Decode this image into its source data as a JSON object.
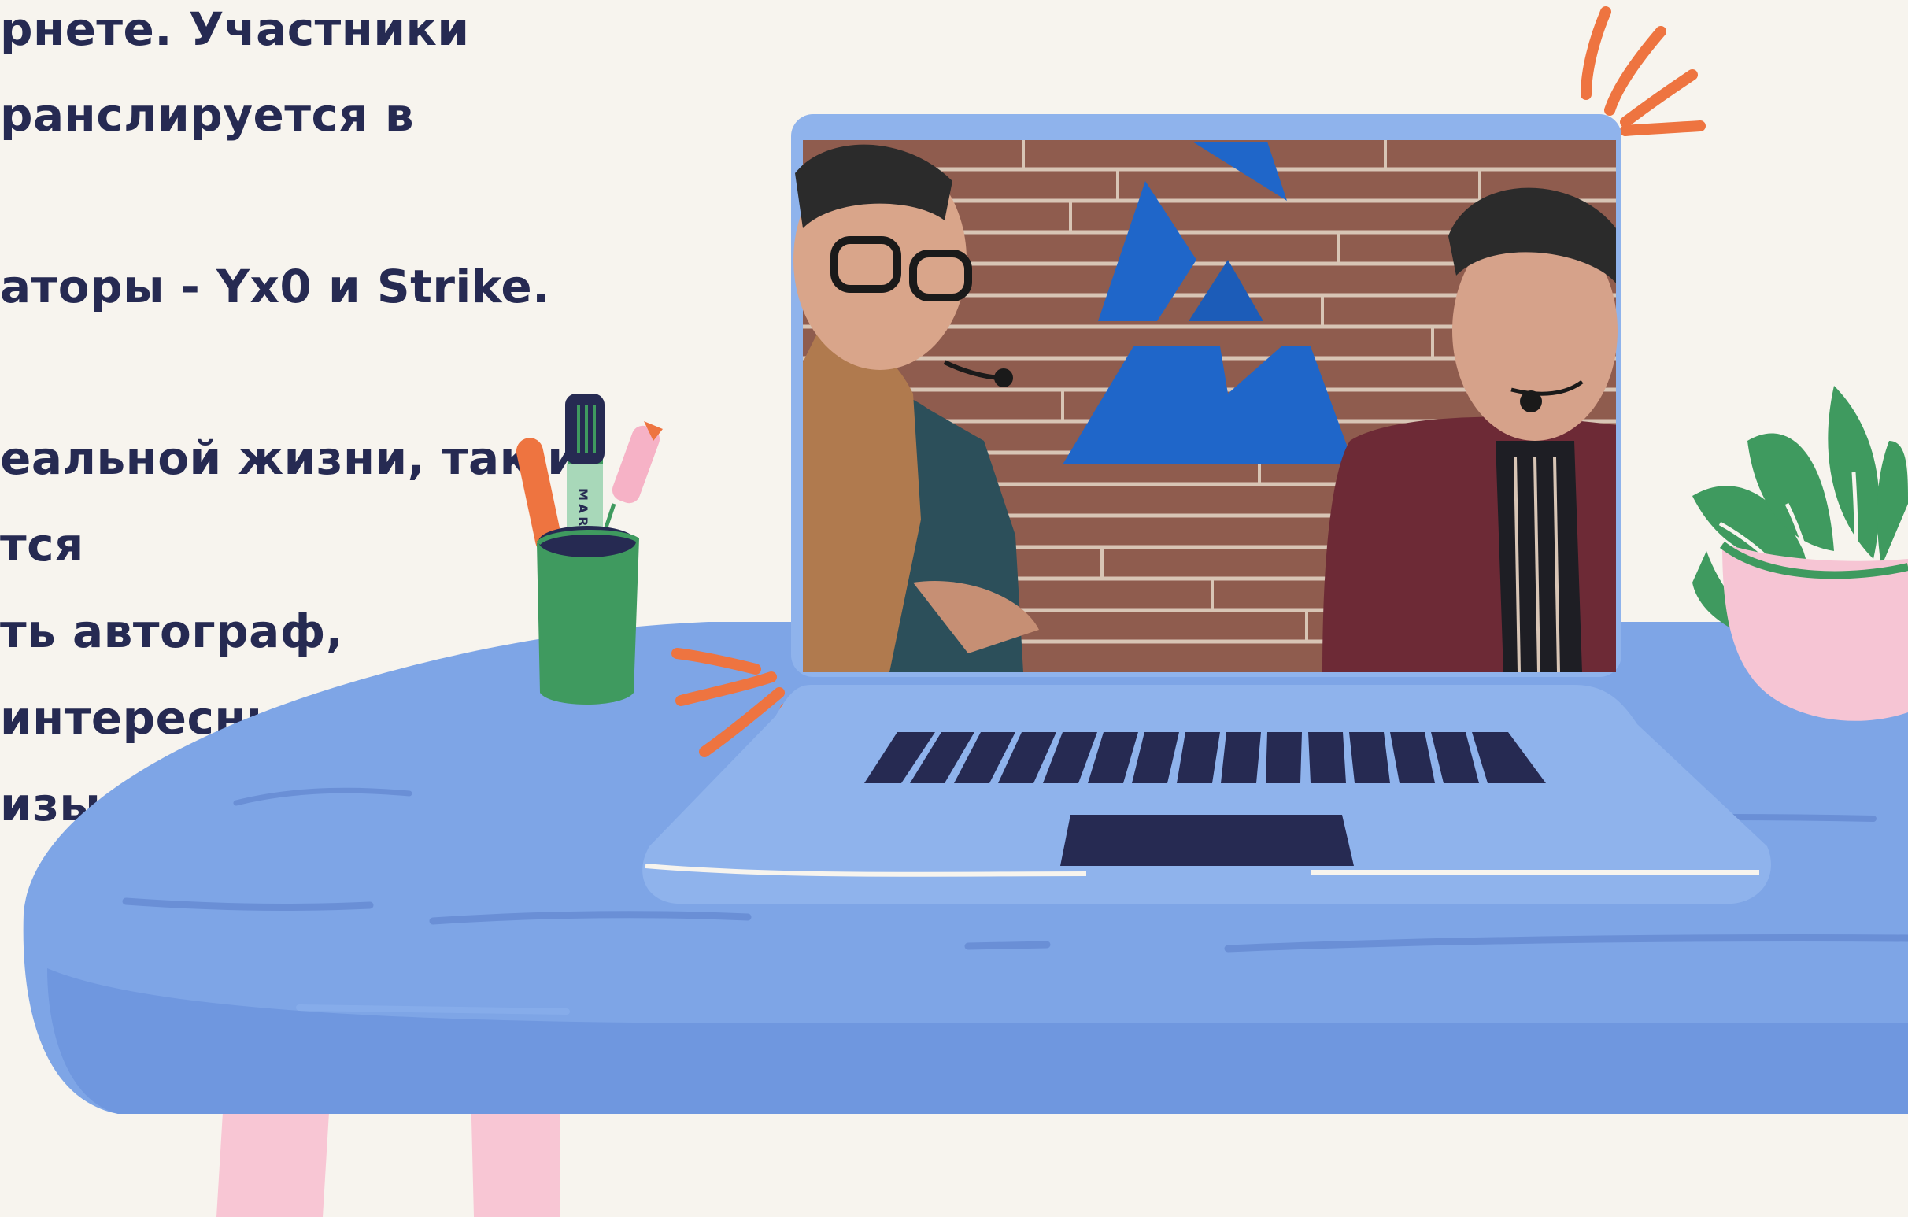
{
  "text_lines": [
    "рнете. Участники",
    "ранслируется в",
    "аторы -  Yx0 и Strike.",
    "еальной жизни, так и",
    "тся",
    "ть автограф,",
    "интересных",
    "изы от"
  ],
  "pen_label": "MARK",
  "colors": {
    "background": "#f7f4ee",
    "text": "#262a52",
    "table": "#7ea5e6",
    "laptop": "#8fb3ec",
    "keys": "#262a52",
    "accent_orange": "#ee7440",
    "cup_green": "#3f9a5f",
    "pot_pink": "#f6c5d4",
    "table_legs": "#f8c6d4"
  },
  "icons": [
    "pen-cup-icon",
    "laptop-icon",
    "plant-icon",
    "sparkle-icon"
  ]
}
